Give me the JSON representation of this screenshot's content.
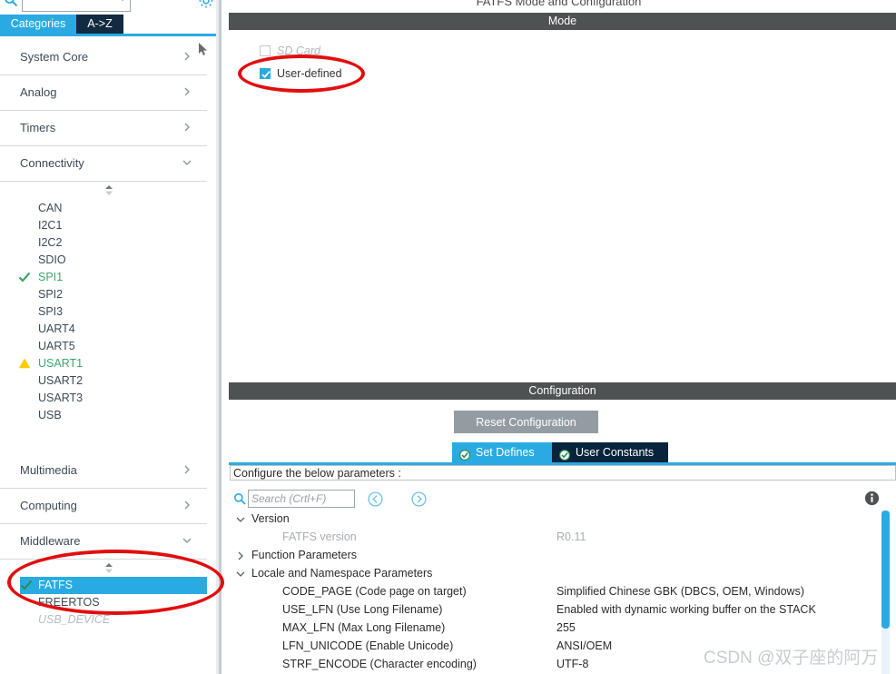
{
  "window": {
    "page_title": "FATFS Mode and Configuration",
    "watermark": "CSDN @双子座的阿万"
  },
  "sidebar": {
    "search_placeholder": "",
    "search_value": "",
    "gear_icon": "gear-icon",
    "tabs": [
      {
        "label": "Categories",
        "active": true
      },
      {
        "label": "A->Z",
        "active": false
      }
    ],
    "categories": [
      {
        "label": "System Core",
        "expanded": false,
        "chevron": "chevron-right-icon"
      },
      {
        "label": "Analog",
        "expanded": false,
        "chevron": "chevron-right-icon"
      },
      {
        "label": "Timers",
        "expanded": false,
        "chevron": "chevron-right-icon"
      },
      {
        "label": "Connectivity",
        "expanded": true,
        "chevron": "chevron-down-icon"
      }
    ],
    "connectivity_items": [
      {
        "label": "CAN",
        "state": "none"
      },
      {
        "label": "I2C1",
        "state": "none"
      },
      {
        "label": "I2C2",
        "state": "none"
      },
      {
        "label": "SDIO",
        "state": "none"
      },
      {
        "label": "SPI1",
        "state": "ok"
      },
      {
        "label": "SPI2",
        "state": "none"
      },
      {
        "label": "SPI3",
        "state": "none"
      },
      {
        "label": "UART4",
        "state": "none"
      },
      {
        "label": "UART5",
        "state": "none"
      },
      {
        "label": "USART1",
        "state": "warn"
      },
      {
        "label": "USART2",
        "state": "none"
      },
      {
        "label": "USART3",
        "state": "none"
      },
      {
        "label": "USB",
        "state": "none"
      }
    ],
    "categories_lower": [
      {
        "label": "Multimedia",
        "expanded": false,
        "chevron": "chevron-right-icon"
      },
      {
        "label": "Computing",
        "expanded": false,
        "chevron": "chevron-right-icon"
      },
      {
        "label": "Middleware",
        "expanded": true,
        "chevron": "chevron-down-icon"
      }
    ],
    "middleware_items": [
      {
        "label": "FATFS",
        "state": "ok",
        "selected": true,
        "disabled": false
      },
      {
        "label": "FREERTOS",
        "state": "none",
        "selected": false,
        "disabled": false
      },
      {
        "label": "USB_DEVICE",
        "state": "none",
        "selected": false,
        "disabled": true
      }
    ]
  },
  "mode_panel": {
    "header": "Mode",
    "checkboxes": [
      {
        "label": "SD Card",
        "checked": false,
        "disabled": true
      },
      {
        "label": "User-defined",
        "checked": true,
        "disabled": false
      }
    ]
  },
  "configuration_panel": {
    "header": "Configuration",
    "reset_button": "Reset Configuration",
    "tabs": [
      {
        "label": "Set Defines",
        "active": true,
        "icon": "check-circle-icon"
      },
      {
        "label": "User Constants",
        "active": false,
        "icon": "check-circle-icon"
      }
    ],
    "instruction": "Configure the below parameters :",
    "search_placeholder": "Search (Crtl+F)",
    "search_value": "",
    "nav_back_icon": "circle-back-arrow-icon",
    "nav_forward_icon": "circle-forward-arrow-icon",
    "info_icon": "info-icon",
    "tree": [
      {
        "type": "group",
        "label": "Version",
        "expanded": true,
        "rows": [
          {
            "key": "FATFS version",
            "value": "R0.11",
            "readonly": true
          }
        ]
      },
      {
        "type": "group",
        "label": "Function Parameters",
        "expanded": false,
        "rows": []
      },
      {
        "type": "group",
        "label": "Locale and Namespace Parameters",
        "expanded": true,
        "rows": [
          {
            "key": "CODE_PAGE (Code page on target)",
            "value": "Simplified Chinese GBK (DBCS, OEM, Windows)",
            "readonly": false
          },
          {
            "key": "USE_LFN (Use Long Filename)",
            "value": "Enabled with dynamic working buffer on the STACK",
            "readonly": false
          },
          {
            "key": "MAX_LFN (Max Long Filename)",
            "value": "255",
            "readonly": false
          },
          {
            "key": "LFN_UNICODE (Enable Unicode)",
            "value": "ANSI/OEM",
            "readonly": false
          },
          {
            "key": "STRF_ENCODE (Character encoding)",
            "value": "UTF-8",
            "readonly": false
          }
        ]
      }
    ]
  },
  "colors": {
    "accent_blue": "#29abe2",
    "dark_navy": "#08243d",
    "band_gray": "#4f5252",
    "ok_green": "#3aa76d",
    "warn_yellow": "#ffcc00",
    "annotation_red": "#e10e0e"
  }
}
